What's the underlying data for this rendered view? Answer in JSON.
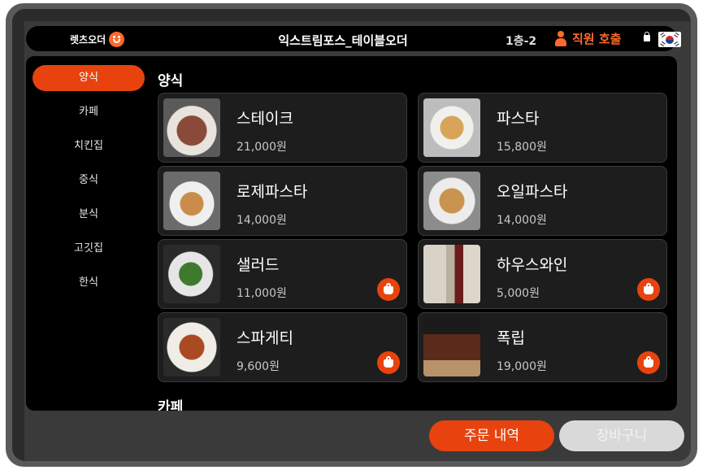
{
  "header": {
    "brand": "렛츠오더",
    "store_title": "익스트림포스_테이블오더",
    "table_no": "1층-2",
    "staff_call": "직원 호출"
  },
  "sidebar": {
    "categories": [
      {
        "label": "양식",
        "active": true
      },
      {
        "label": "카페"
      },
      {
        "label": "치킨집"
      },
      {
        "label": "중식"
      },
      {
        "label": "분식"
      },
      {
        "label": "고깃집"
      },
      {
        "label": "한식"
      }
    ]
  },
  "main": {
    "section_title": "양식",
    "next_section_title": "카페",
    "items": [
      {
        "name": "스테이크",
        "price": "21,000원"
      },
      {
        "name": "파스타",
        "price": "15,800원"
      },
      {
        "name": "로제파스타",
        "price": "14,000원"
      },
      {
        "name": "오일파스타",
        "price": "14,000원"
      },
      {
        "name": "샐러드",
        "price": "11,000원"
      },
      {
        "name": "하우스와인",
        "price": "5,000원"
      },
      {
        "name": "스파게티",
        "price": "9,600원"
      },
      {
        "name": "폭립",
        "price": "19,000원"
      }
    ]
  },
  "footer": {
    "orders_label": "주문 내역",
    "cart_label": "장바구니"
  },
  "colors": {
    "accent": "#e8430e",
    "background": "#000000",
    "card": "#1d1d1d"
  }
}
